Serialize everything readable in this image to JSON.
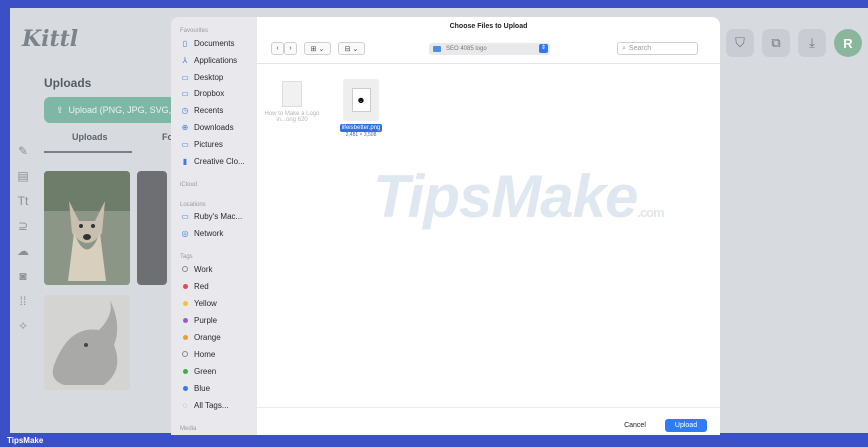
{
  "app": {
    "logo": "Kittl",
    "uploads_title": "Uploads",
    "upload_button": "Upload (PNG, JPG, SVG,",
    "tabs": [
      "Uploads",
      "Fo"
    ],
    "avatar_initial": "R",
    "rail_icons": [
      "edit-icon",
      "layout-icon",
      "text-icon",
      "shapes-icon",
      "upload-icon",
      "camera-icon",
      "grid-icon",
      "sparkle-icon"
    ]
  },
  "dialog": {
    "title": "Choose Files to Upload",
    "location": "SEO 4085 logo",
    "search_placeholder": "Search",
    "favourites_label": "Favourites",
    "favourites": [
      {
        "label": "Documents",
        "icon": "document-icon",
        "glyph": "▯"
      },
      {
        "label": "Applications",
        "icon": "applications-icon",
        "glyph": "⅄"
      },
      {
        "label": "Desktop",
        "icon": "desktop-icon",
        "glyph": "▭"
      },
      {
        "label": "Dropbox",
        "icon": "dropbox-icon",
        "glyph": "▭"
      },
      {
        "label": "Recents",
        "icon": "recents-icon",
        "glyph": "◷"
      },
      {
        "label": "Downloads",
        "icon": "downloads-icon",
        "glyph": "⊕"
      },
      {
        "label": "Pictures",
        "icon": "pictures-icon",
        "glyph": "▭"
      },
      {
        "label": "Creative Clo...",
        "icon": "creative-cloud-icon",
        "glyph": "▮"
      }
    ],
    "icloud_label": "iCloud",
    "locations_label": "Locations",
    "locations": [
      {
        "label": "Ruby's Mac...",
        "icon": "laptop-icon",
        "glyph": "▭"
      },
      {
        "label": "Network",
        "icon": "network-icon",
        "glyph": "◎"
      }
    ],
    "tags_label": "Tags",
    "tags": [
      {
        "label": "Work",
        "color": ""
      },
      {
        "label": "Red",
        "color": "#e5484d"
      },
      {
        "label": "Yellow",
        "color": "#f4c430"
      },
      {
        "label": "Purple",
        "color": "#9b59d0"
      },
      {
        "label": "Orange",
        "color": "#f39a2b"
      },
      {
        "label": "Home",
        "color": ""
      },
      {
        "label": "Green",
        "color": "#34b24a"
      },
      {
        "label": "Blue",
        "color": "#2f7bf5"
      },
      {
        "label": "All Tags...",
        "color": "tags"
      }
    ],
    "media_label": "Media",
    "files": [
      {
        "name": "How to Make a Logo in...ong 620",
        "selected": false
      },
      {
        "name": "lifeisbetter.png",
        "dims": "2,481 × 3,508",
        "selected": true
      }
    ],
    "cancel": "Cancel",
    "upload": "Upload"
  },
  "watermark": {
    "main": "TipsMake",
    "suffix": ".com"
  },
  "brand_footer": "TipsMake",
  "colors": {
    "accent": "#2f7bf5",
    "frame": "#3b4fc7",
    "kittl_green": "#7fb7a6"
  }
}
